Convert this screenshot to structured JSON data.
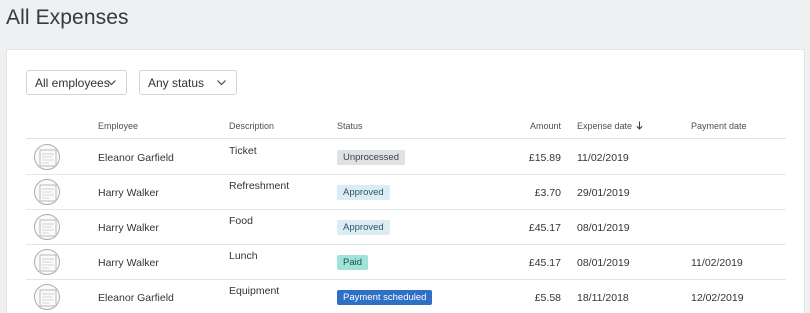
{
  "page": {
    "title": "All Expenses"
  },
  "filters": {
    "employees": {
      "label": "All employees"
    },
    "status": {
      "label": "Any status"
    }
  },
  "table": {
    "columns": {
      "employee": "Employee",
      "description": "Description",
      "status": "Status",
      "amount": "Amount",
      "expense_date": "Expense date",
      "payment_date": "Payment date"
    },
    "sort": {
      "column": "expense_date",
      "direction": "descending"
    },
    "rows": [
      {
        "employee": "Eleanor Garfield",
        "description": "Ticket",
        "status": "Unprocessed",
        "amount": "£15.89",
        "expense_date": "11/02/2019",
        "payment_date": ""
      },
      {
        "employee": "Harry Walker",
        "description": "Refreshment",
        "status": "Approved",
        "amount": "£3.70",
        "expense_date": "29/01/2019",
        "payment_date": ""
      },
      {
        "employee": "Harry Walker",
        "description": "Food",
        "status": "Approved",
        "amount": "£45.17",
        "expense_date": "08/01/2019",
        "payment_date": ""
      },
      {
        "employee": "Harry Walker",
        "description": "Lunch",
        "status": "Paid",
        "amount": "£45.17",
        "expense_date": "08/01/2019",
        "payment_date": "11/02/2019"
      },
      {
        "employee": "Eleanor Garfield",
        "description": "Equipment",
        "status": "Payment scheduled",
        "amount": "£5.58",
        "expense_date": "18/11/2018",
        "payment_date": "12/02/2019"
      }
    ]
  },
  "status_colors": {
    "Unprocessed": {
      "bg": "#dfe2e5",
      "fg": "#3d4247"
    },
    "Approved": {
      "bg": "#dbecf3",
      "fg": "#2f5566"
    },
    "Paid": {
      "bg": "#9fe3d9",
      "fg": "#1f4c46"
    },
    "Payment scheduled": {
      "bg": "#2f6fc4",
      "fg": "#ffffff"
    }
  }
}
